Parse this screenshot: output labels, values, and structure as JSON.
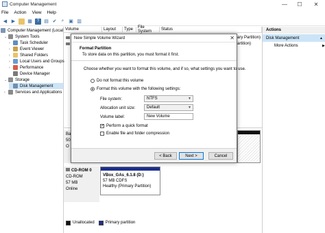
{
  "window": {
    "title": "Computer Management"
  },
  "window_controls": [
    "—",
    "☐",
    "✕"
  ],
  "menu": [
    "File",
    "Action",
    "View",
    "Help"
  ],
  "tree": [
    {
      "label": "Computer Management (Local"
    },
    {
      "label": "System Tools"
    },
    {
      "label": "Task Scheduler"
    },
    {
      "label": "Event Viewer"
    },
    {
      "label": "Shared Folders"
    },
    {
      "label": "Local Users and Groups"
    },
    {
      "label": "Performance"
    },
    {
      "label": "Device Manager"
    },
    {
      "label": "Storage"
    },
    {
      "label": "Disk Management"
    },
    {
      "label": "Services and Applications"
    }
  ],
  "columns": [
    "Volume",
    "Layout",
    "Type",
    "File System",
    "Status"
  ],
  "list_fragments": {
    "status_tail": "ary Partition)",
    "row2_tail": "artition)"
  },
  "actions": {
    "header": "Actions",
    "selected": "Disk Management",
    "more": "More Actions"
  },
  "disks": {
    "d1_a": "Ba",
    "d1_b": "50",
    "d1_c": "O",
    "cd_name": "CD-ROM 0",
    "cd_type": "CD-ROM",
    "cd_size": "57 MB",
    "cd_status": "Online",
    "part_name": "VBox_GAs_6.1.8  (D:)",
    "part_size": "57 MB CDFS",
    "part_status": "Healthy (Primary Partition)"
  },
  "legend": {
    "unallocated": "Unallocated",
    "primary": "Primary partition"
  },
  "wizard": {
    "title": "New Simple Volume Wizard",
    "header": "Format Partition",
    "description": "To store data on this partition, you must format it first.",
    "prompt": "Choose whether you want to format this volume, and if so, what settings you want to use.",
    "option_no": "Do not format this volume",
    "option_yes": "Format this volume with the following settings:",
    "fs_label": "File system:",
    "fs_value": "NTFS",
    "alloc_label": "Allocation unit size:",
    "alloc_value": "Default",
    "vol_label": "Volume label:",
    "vol_value": "New Volume",
    "quick_format": "Perform a quick format",
    "compression": "Enable file and folder compression",
    "back": "< Back",
    "next": "Next >",
    "cancel": "Cancel"
  },
  "colors": {
    "accent": "#0078d7",
    "selection": "#cce4f7",
    "partition_bar": "#1c2e8c"
  }
}
